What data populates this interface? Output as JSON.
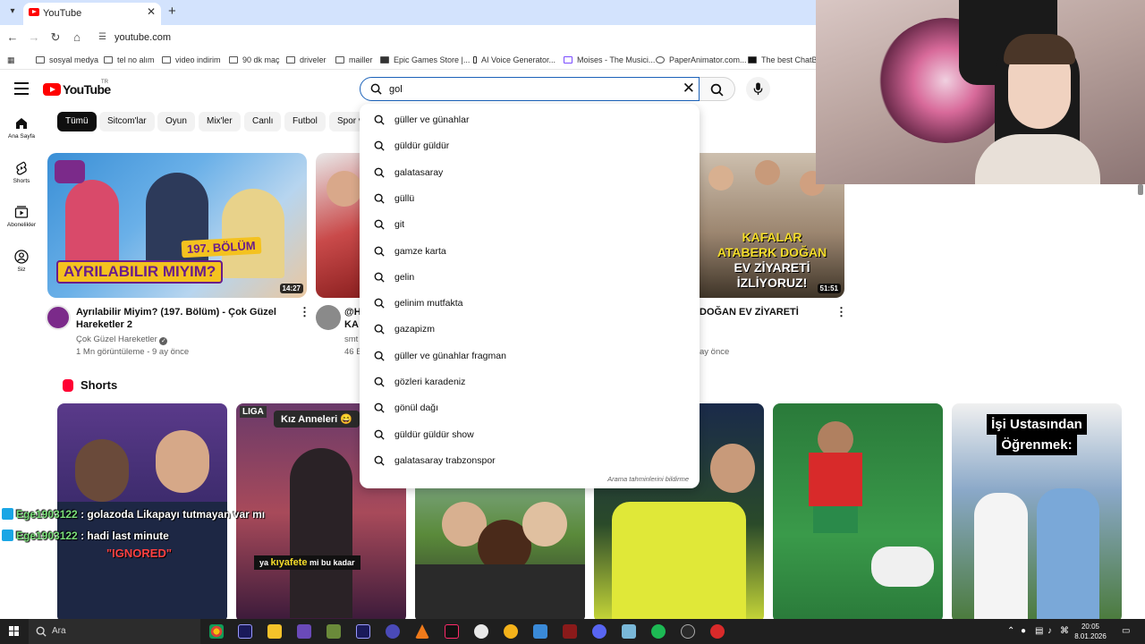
{
  "browser": {
    "tab_title": "YouTube",
    "url": "youtube.com",
    "bookmarks": [
      "sosyal medya",
      "tel no alım",
      "video indirim",
      "90 dk maç",
      "driveler",
      "mailler",
      "Epic Games Store |...",
      "AI Voice Generator...",
      "Moises - The Musici...",
      "PaperAnimator.com...",
      "The best ChatBot"
    ]
  },
  "masthead": {
    "logo_text": "YouTube",
    "logo_region": "TR",
    "search_value": "gol"
  },
  "guide": [
    {
      "label": "Ana Sayfa",
      "icon": "home-icon"
    },
    {
      "label": "Shorts",
      "icon": "shorts-icon"
    },
    {
      "label": "Abonelikler",
      "icon": "subscriptions-icon"
    },
    {
      "label": "Siz",
      "icon": "you-icon"
    }
  ],
  "chips": [
    "Tümü",
    "Sitcom'lar",
    "Oyun",
    "Mix'ler",
    "Canlı",
    "Futbol",
    "Spor v"
  ],
  "suggestions": {
    "items": [
      "güller ve günahlar",
      "güldür güldür",
      "galatasaray",
      "güllü",
      "git",
      "gamze karta",
      "gelin",
      "gelinim mutfakta",
      "gazapizm",
      "güller ve günahlar fragman",
      "gözleri karadeniz",
      "gönül dağı",
      "güldür güldür show",
      "galatasaray trabzonspor"
    ],
    "footer": "Arama tahminlerini bildirme"
  },
  "videos": {
    "v1": {
      "title": "Ayrılabilir Miyim? (197. Bölüm) - Çok Güzel Hareketler 2",
      "channel": "Çok Güzel Hareketler",
      "meta": "1 Mn görüntüleme - 9 ay önce",
      "duration": "14:27",
      "thumb_caption": "AYRILABILIR MIYIM?",
      "thumb_badge": "197. BÖLÜM"
    },
    "v2": {
      "title_a": "@H",
      "title_b": "KA",
      "channel": "smt",
      "meta": "46 E"
    },
    "v3": {
      "title": "DOĞAN EV ZİYARETİ",
      "meta": "ay önce",
      "duration": "51:51",
      "thumb_lines": [
        "KAFALAR",
        "ATABERK DOĞAN",
        "EV ZİYARETİ",
        "İZLİYORUZ!"
      ]
    }
  },
  "shorts": {
    "title": "Shorts",
    "s1_text": "\"IGNORED\"",
    "s2_tag": "LIGA",
    "s2_top": "Kız Anneleri 😄",
    "s2_caption_a": "ya ",
    "s2_caption_b": "kıyafete",
    "s2_caption_c": " mi bu kadar",
    "s6_text_a": "İşi Ustasından",
    "s6_text_b": "Öğrenmek:"
  },
  "chat": [
    {
      "user": "Ege1903122",
      "message": " : golazoda Likapayı tutmayan var mı"
    },
    {
      "user": "Ege1903122",
      "message": " : hadi last minute"
    }
  ],
  "taskbar": {
    "search_label": "Ara",
    "time": "20:05",
    "date": "8.01.2026"
  },
  "colors": {
    "youtube_red": "#ff0000",
    "chrome_tab_bg": "#d3e3fd",
    "chip_active": "#0f0f0f",
    "taskbar": "#1f1f1f",
    "chat_username": "#7be07b"
  }
}
